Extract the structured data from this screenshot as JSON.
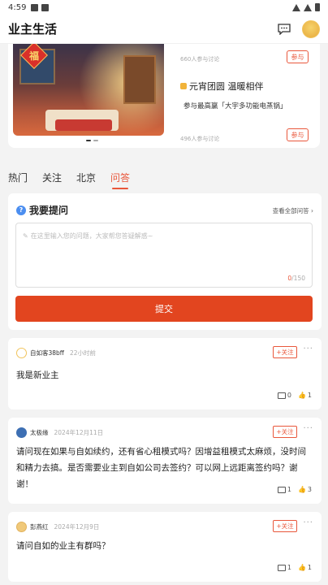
{
  "status_bar": {
    "time": "4:59"
  },
  "app_bar": {
    "title": "业主生活",
    "message_icon": "message-icon",
    "avatar": "user-avatar"
  },
  "banner": {
    "badge": "福",
    "activities": [
      {
        "count": "660人参与讨论",
        "join": "参与"
      },
      {
        "title": "元宵团圆 温暖相伴",
        "subtitle": "参与最高赢「大宇多功能电蒸锅」",
        "count": "496人参与讨论",
        "join": "参与"
      }
    ]
  },
  "tabs": [
    {
      "label": "热门",
      "active": false
    },
    {
      "label": "关注",
      "active": false
    },
    {
      "label": "北京",
      "active": false
    },
    {
      "label": "问答",
      "active": true
    }
  ],
  "ask": {
    "title": "我要提问",
    "view_all": "查看全部问答",
    "placeholder": "在这里输入您的问题，大家帮您答疑解惑~",
    "count_current": "0",
    "count_max": "/150",
    "submit": "提交"
  },
  "posts": [
    {
      "user": "自如客38bff",
      "time": "22小时前",
      "follow": "+关注",
      "text": "我是新业主",
      "comments": "0",
      "likes": "1"
    },
    {
      "user": "太极缘",
      "time": "2024年12月11日",
      "follow": "+关注",
      "text": "请问现在如果与自如续约，还有省心租模式吗？因增益租模式太麻烦，没时间和精力去搞。是否需要业主到自如公司去签约？可以网上远距离签约吗？谢谢！",
      "comments": "1",
      "likes": "3"
    },
    {
      "user": "彭燕红",
      "time": "2024年12月9日",
      "follow": "+关注",
      "text": "请问自如的业主有群吗？",
      "comments": "1",
      "likes": "1"
    }
  ],
  "colors": {
    "accent": "#e9573b",
    "submit": "#e2451f"
  }
}
